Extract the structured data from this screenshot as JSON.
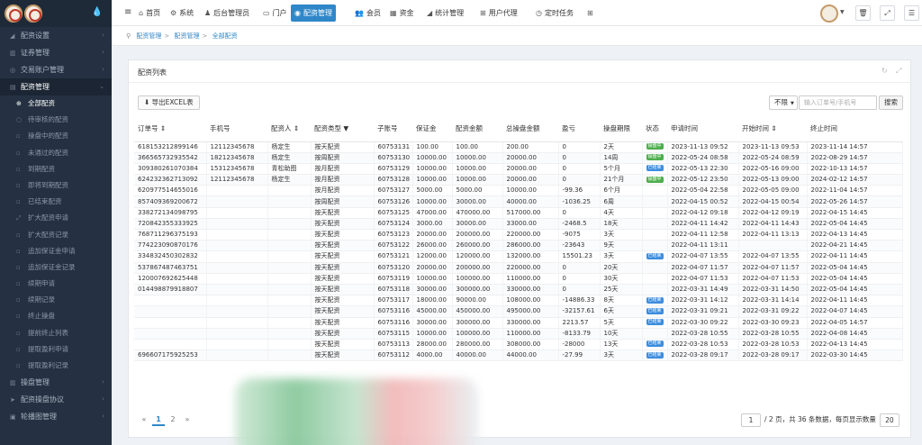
{
  "sidebar": {
    "items": [
      {
        "label": "配资设置",
        "icon": "chart-icon"
      },
      {
        "label": "证券管理",
        "icon": "bars-icon"
      },
      {
        "label": "交易账户管理",
        "icon": "globe-icon"
      },
      {
        "label": "配资管理",
        "icon": "list-icon"
      }
    ],
    "subitems": [
      {
        "label": "全部配资",
        "icon": "plus-circle-icon"
      },
      {
        "label": "待审核的配资",
        "icon": "circle-icon"
      },
      {
        "label": "操盘中的配资",
        "icon": "square-icon"
      },
      {
        "label": "未通过的配资",
        "icon": "square-icon"
      },
      {
        "label": "到期配资",
        "icon": "square-icon"
      },
      {
        "label": "即将到期配资",
        "icon": "square-icon"
      },
      {
        "label": "已结束配资",
        "icon": "square-icon"
      },
      {
        "label": "扩大配资申请",
        "icon": "expand-icon"
      },
      {
        "label": "扩大配资记录",
        "icon": "square-icon"
      },
      {
        "label": "追加保证金申请",
        "icon": "square-icon"
      },
      {
        "label": "追加保证金记录",
        "icon": "square-icon"
      },
      {
        "label": "续期申请",
        "icon": "square-icon"
      },
      {
        "label": "续期记录",
        "icon": "square-icon"
      },
      {
        "label": "终止操盘",
        "icon": "square-icon"
      },
      {
        "label": "提前终止列表",
        "icon": "square-icon"
      },
      {
        "label": "提取盈利申请",
        "icon": "square-icon"
      },
      {
        "label": "提取盈利记录",
        "icon": "square-icon"
      }
    ],
    "bottom_items": [
      {
        "label": "操盘管理",
        "icon": "bars-icon"
      },
      {
        "label": "配资操盘协议",
        "icon": "send-icon"
      },
      {
        "label": "轮播图管理",
        "icon": "image-icon"
      }
    ]
  },
  "topnav": {
    "items": [
      {
        "label": "首页",
        "icon": "home-icon"
      },
      {
        "label": "系统",
        "icon": "gear-icon"
      },
      {
        "label": "后台管理员",
        "icon": "user-icon"
      },
      {
        "label": "门户",
        "icon": "monitor-icon"
      },
      {
        "label": "配资管理",
        "icon": "disc-icon"
      },
      {
        "label": "会员",
        "icon": "users-icon"
      },
      {
        "label": "资金",
        "icon": "wallet-icon"
      },
      {
        "label": "统计管理",
        "icon": "chart-icon"
      },
      {
        "label": "用户代理",
        "icon": "org-icon"
      },
      {
        "label": "定时任务",
        "icon": "clock-icon"
      },
      {
        "label": "",
        "icon": "grid-icon"
      }
    ]
  },
  "breadcrumb": [
    "配资管理",
    "配资管理",
    "全部配资"
  ],
  "card": {
    "title": "配资列表"
  },
  "toolbar": {
    "export_label": "导出EXCEL表",
    "limit_value": "不限",
    "search_placeholder": "输入订单号/手机号",
    "search_label": "搜索"
  },
  "table": {
    "headers": [
      "订单号 ⇕",
      "手机号",
      "配资人 ⇕",
      "配资类型 ▼",
      "子账号",
      "保证金",
      "配资金额",
      "总操盘金额",
      "盈亏",
      "操盘期限",
      "状态",
      "申请时间",
      "开始时间 ⇕",
      "终止时间"
    ],
    "rows": [
      [
        "618153212899146",
        "12112345678",
        "杨定生",
        "按天配资",
        "60753131",
        "100.00",
        "100.00",
        "200.00",
        "0",
        "2天",
        {
          "t": "操盘中",
          "c": "green"
        },
        "2023-11-13 09:52",
        "2023-11-13 09:53",
        "2023-11-14 14:57"
      ],
      [
        "366565732935542",
        "18212345678",
        "杨定生",
        "按周配资",
        "60753130",
        "10000.00",
        "10000.00",
        "20000.00",
        "0",
        "14周",
        {
          "t": "操盘中",
          "c": "green"
        },
        "2022-05-24 08:58",
        "2022-05-24 08:59",
        "2022-08-29 14:57"
      ],
      [
        "309380261070384",
        "15312345678",
        "青松助图",
        "按月配资",
        "60753129",
        "10000.00",
        "10000.00",
        "20000.00",
        "0",
        "5个月",
        {
          "t": "已结束",
          "c": "blue"
        },
        "2022-05-13 22:30",
        "2022-05-16 09:00",
        "2022-10-13 14:57"
      ],
      [
        "624232362713092",
        "12112345678",
        "杨定生",
        "按月配资",
        "60753128",
        "10000.00",
        "10000.00",
        "20000.00",
        "0",
        "21个月",
        {
          "t": "操盘中",
          "c": "green"
        },
        "2022-05-12 23:50",
        "2022-05-13 09:00",
        "2024-02-12 14:57"
      ],
      [
        "620977514655016",
        "",
        "",
        "按月配资",
        "60753127",
        "5000.00",
        "5000.00",
        "10000.00",
        "-99.36",
        "6个月",
        "",
        "2022-05-04 22:58",
        "2022-05-05 09:00",
        "2022-11-04 14:57"
      ],
      [
        "857409369200672",
        "",
        "",
        "按周配资",
        "60753126",
        "10000.00",
        "30000.00",
        "40000.00",
        "-1036.25",
        "6周",
        "",
        "2022-04-15 00:52",
        "2022-04-15 00:54",
        "2022-05-26 14:57"
      ],
      [
        "338272134098795",
        "",
        "",
        "按天配资",
        "60753125",
        "47000.00",
        "470000.00",
        "517000.00",
        "0",
        "4天",
        "",
        "2022-04-12 09:18",
        "2022-04-12 09:19",
        "2022-04-15 14:45"
      ],
      [
        "720842355333925",
        "",
        "",
        "按天配资",
        "60753124",
        "3000.00",
        "30000.00",
        "33000.00",
        "-2468.5",
        "18天",
        "",
        "2022-04-11 14:42",
        "2022-04-11 14:43",
        "2022-05-04 14:45"
      ],
      [
        "768711296375193",
        "",
        "",
        "按天配资",
        "60753123",
        "20000.00",
        "200000.00",
        "220000.00",
        "-9075",
        "3天",
        "",
        "2022-04-11 12:58",
        "2022-04-11 13:13",
        "2022-04-13 14:45"
      ],
      [
        "774223090870176",
        "",
        "",
        "按天配资",
        "60753122",
        "26000.00",
        "260000.00",
        "286000.00",
        "-23643",
        "9天",
        "",
        "2022-04-11 13:11",
        "",
        "2022-04-21 14:45"
      ],
      [
        "334832450302832",
        "",
        "",
        "按天配资",
        "60753121",
        "12000.00",
        "120000.00",
        "132000.00",
        "15501.23",
        "3天",
        {
          "t": "已结束",
          "c": "blue"
        },
        "2022-04-07 13:55",
        "2022-04-07 13:55",
        "2022-04-11 14:45"
      ],
      [
        "537867487463751",
        "",
        "",
        "按天配资",
        "60753120",
        "20000.00",
        "200000.00",
        "220000.00",
        "0",
        "20天",
        "",
        "2022-04-07 11:57",
        "2022-04-07 11:57",
        "2022-05-04 14:45"
      ],
      [
        "120007692625448",
        "",
        "",
        "按天配资",
        "60753119",
        "10000.00",
        "100000.00",
        "110000.00",
        "0",
        "30天",
        "",
        "2022-04-07 11:53",
        "2022-04-07 11:53",
        "2022-05-04 14:45"
      ],
      [
        "014498879918807",
        "",
        "",
        "按天配资",
        "60753118",
        "30000.00",
        "300000.00",
        "330000.00",
        "0",
        "25天",
        "",
        "2022-03-31 14:49",
        "2022-03-31 14:50",
        "2022-05-04 14:45"
      ],
      [
        "",
        "",
        "",
        "按天配资",
        "60753117",
        "18000.00",
        "90000.00",
        "108000.00",
        "-14886.33",
        "8天",
        {
          "t": "已结束",
          "c": "blue"
        },
        "2022-03-31 14:12",
        "2022-03-31 14:14",
        "2022-04-11 14:45"
      ],
      [
        "",
        "",
        "",
        "按天配资",
        "60753116",
        "45000.00",
        "450000.00",
        "495000.00",
        "-32157.61",
        "6天",
        {
          "t": "已结束",
          "c": "blue"
        },
        "2022-03-31 09:21",
        "2022-03-31 09:22",
        "2022-04-07 14:45"
      ],
      [
        "",
        "",
        "",
        "按天配资",
        "60753116",
        "30000.00",
        "300000.00",
        "330000.00",
        "2213.57",
        "5天",
        {
          "t": "已结束",
          "c": "blue"
        },
        "2022-03-30 09:22",
        "2022-03-30 09:23",
        "2022-04-05 14:57"
      ],
      [
        "",
        "",
        "",
        "按天配资",
        "60753115",
        "10000.00",
        "100000.00",
        "110000.00",
        "-8133.79",
        "10天",
        "",
        "2022-03-28 10:55",
        "2022-03-28 10:55",
        "2022-04-08 14:45"
      ],
      [
        "",
        "",
        "",
        "按天配资",
        "60753113",
        "28000.00",
        "280000.00",
        "308000.00",
        "-28000",
        "13天",
        {
          "t": "已结束",
          "c": "blue"
        },
        "2022-03-28 10:53",
        "2022-03-28 10:53",
        "2022-04-13 14:45"
      ],
      [
        "696607175925253",
        "",
        "",
        "按天配资",
        "60753112",
        "4000.00",
        "40000.00",
        "44000.00",
        "-27.99",
        "3天",
        {
          "t": "已结束",
          "c": "blue"
        },
        "2022-03-28 09:17",
        "2022-03-28 09:17",
        "2022-03-30 14:45"
      ]
    ]
  },
  "pagination": {
    "prev": "«",
    "pages": [
      "1",
      "2"
    ],
    "next": "»",
    "current_page": "1",
    "summary": "/ 2 页，共 36 条数据，每页显示数量",
    "page_size": "20"
  }
}
